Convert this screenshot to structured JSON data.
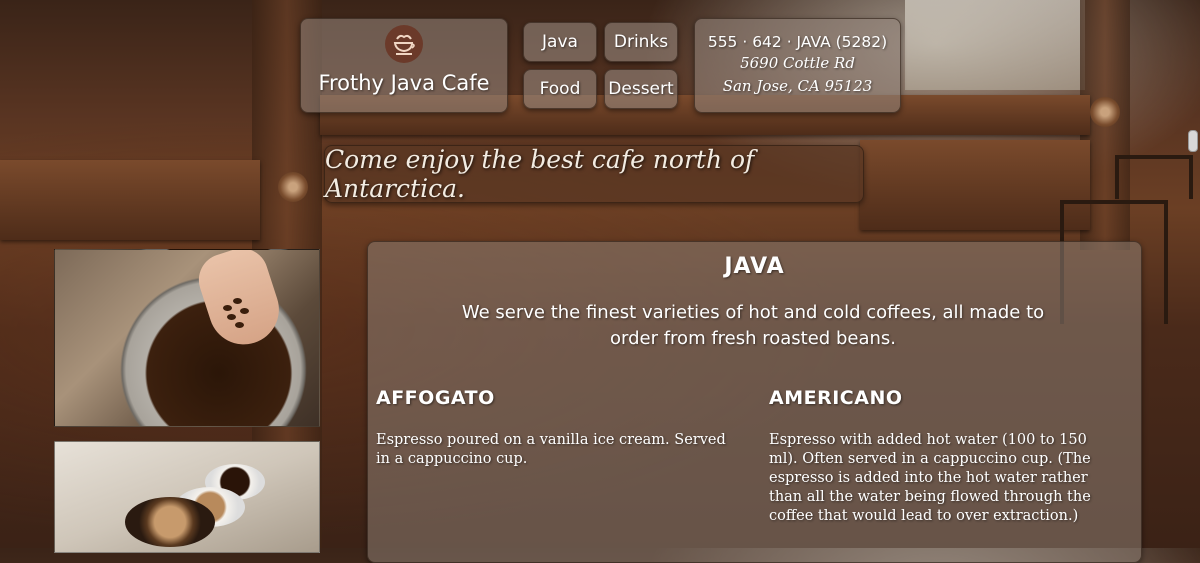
{
  "header": {
    "logo_title": "Frothy Java Cafe",
    "nav": [
      {
        "label": "Java"
      },
      {
        "label": "Drinks"
      },
      {
        "label": "Food"
      },
      {
        "label": "Dessert"
      }
    ],
    "contact": {
      "phone": "555 · 642 · JAVA (5282)",
      "street": "5690 Cottle Rd",
      "city": "San Jose, CA 95123"
    },
    "tagline": "Come enjoy the best cafe north of Antarctica."
  },
  "main": {
    "title": "JAVA",
    "description": "We serve the finest varieties of hot and cold coffees, all made to order from fresh roasted beans.",
    "items": [
      {
        "name": "AFFOGATO",
        "description": "Espresso poured on a vanilla ice cream. Served in a cappuccino cup."
      },
      {
        "name": "AMERICANO",
        "description": "Espresso with added hot water (100 to 150 ml). Often served in a cappuccino cup. (The espresso is added into the hot water rather than all the water being flowed through the coffee that would lead to over extraction.)"
      }
    ]
  },
  "colors": {
    "panel": "#968779",
    "logo_circle": "#6b3a2a",
    "text": "#ffffff"
  }
}
